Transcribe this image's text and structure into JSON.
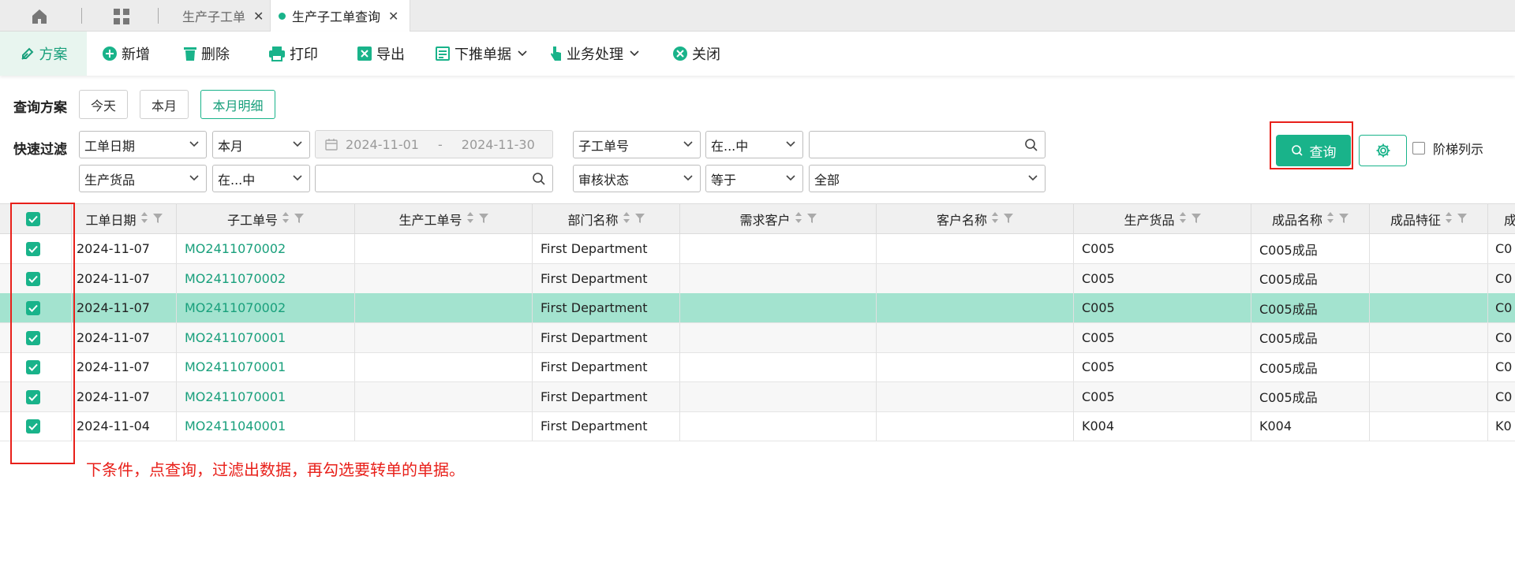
{
  "tabs": [
    {
      "label": "生产子工单",
      "active": false
    },
    {
      "label": "生产子工单查询",
      "active": true
    }
  ],
  "toolbar": {
    "scheme": "方案",
    "add": "新增",
    "delete": "删除",
    "print": "打印",
    "export": "导出",
    "push_down": "下推单据",
    "business": "业务处理",
    "close": "关闭"
  },
  "query_scheme": {
    "label": "查询方案",
    "options": [
      "今天",
      "本月",
      "本月明细"
    ],
    "selected": "本月明细"
  },
  "quick_filter": {
    "label": "快速过滤",
    "row1": {
      "field1": "工单日期",
      "op1": "本月",
      "date_start": "2024-11-01",
      "date_sep": "-",
      "date_end": "2024-11-30",
      "field2": "子工单号",
      "op2": "在...中",
      "value2": ""
    },
    "row2": {
      "field1": "生产货品",
      "op1": "在...中",
      "value1": "",
      "field2": "审核状态",
      "op2": "等于",
      "value2": "全部"
    },
    "query_button": "查询",
    "ladder_label": "阶梯列示"
  },
  "grid": {
    "columns": [
      "工单日期",
      "子工单号",
      "生产工单号",
      "部门名称",
      "需求客户",
      "客户名称",
      "生产货品",
      "成品名称",
      "成品特征",
      "成"
    ],
    "rows": [
      {
        "date": "2024-11-07",
        "sub_no": "MO2411070002",
        "prod_no": "",
        "dept": "First Department",
        "demand_cust": "",
        "cust_name": "",
        "goods": "C005",
        "product_name": "C005成品",
        "feature": "",
        "extra": "C0"
      },
      {
        "date": "2024-11-07",
        "sub_no": "MO2411070002",
        "prod_no": "",
        "dept": "First Department",
        "demand_cust": "",
        "cust_name": "",
        "goods": "C005",
        "product_name": "C005成品",
        "feature": "",
        "extra": "C0"
      },
      {
        "date": "2024-11-07",
        "sub_no": "MO2411070002",
        "prod_no": "",
        "dept": "First Department",
        "demand_cust": "",
        "cust_name": "",
        "goods": "C005",
        "product_name": "C005成品",
        "feature": "",
        "extra": "C0"
      },
      {
        "date": "2024-11-07",
        "sub_no": "MO2411070001",
        "prod_no": "",
        "dept": "First Department",
        "demand_cust": "",
        "cust_name": "",
        "goods": "C005",
        "product_name": "C005成品",
        "feature": "",
        "extra": "C0"
      },
      {
        "date": "2024-11-07",
        "sub_no": "MO2411070001",
        "prod_no": "",
        "dept": "First Department",
        "demand_cust": "",
        "cust_name": "",
        "goods": "C005",
        "product_name": "C005成品",
        "feature": "",
        "extra": "C0"
      },
      {
        "date": "2024-11-07",
        "sub_no": "MO2411070001",
        "prod_no": "",
        "dept": "First Department",
        "demand_cust": "",
        "cust_name": "",
        "goods": "C005",
        "product_name": "C005成品",
        "feature": "",
        "extra": "C0"
      },
      {
        "date": "2024-11-04",
        "sub_no": "MO2411040001",
        "prod_no": "",
        "dept": "First Department",
        "demand_cust": "",
        "cust_name": "",
        "goods": "K004",
        "product_name": "K004",
        "feature": "",
        "extra": "K0"
      }
    ],
    "highlight_row_index": 2
  },
  "annotation": {
    "note": "下条件，点查询，过滤出数据，再勾选要转单的单据。"
  },
  "colors": {
    "accent": "#19b38a",
    "highlight_row": "#a3e3cf",
    "annotation_red": "#e8201a"
  }
}
